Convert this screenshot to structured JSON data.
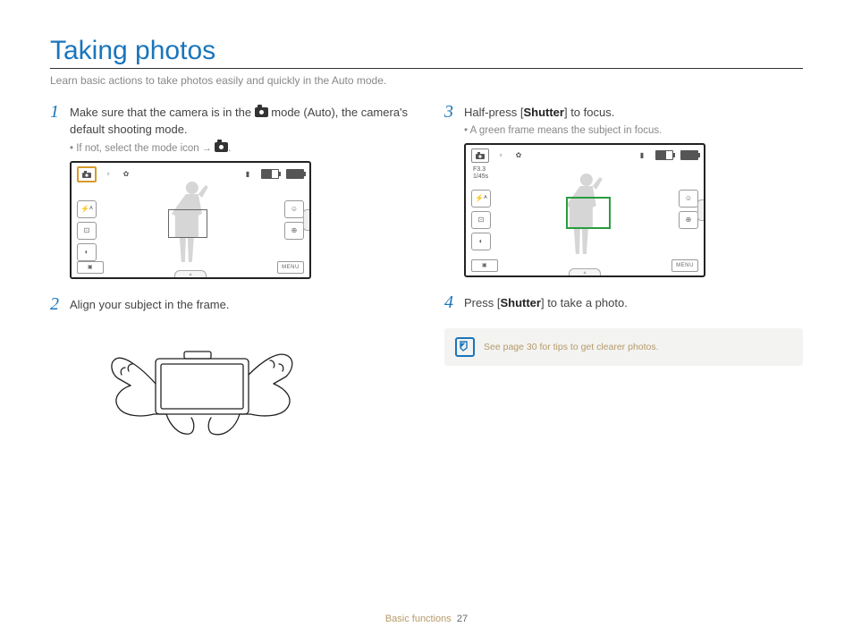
{
  "title": "Taking photos",
  "intro": "Learn basic actions to take photos easily and quickly in the Auto mode.",
  "steps": {
    "s1": {
      "num": "1",
      "text_a": "Make sure that the camera is in the ",
      "text_b": " mode (Auto), the camera's default shooting mode.",
      "bullet_a": "If not, select the mode icon ",
      "arrow": "→",
      "bullet_b": "."
    },
    "s2": {
      "num": "2",
      "text": "Align your subject in the frame."
    },
    "s3": {
      "num": "3",
      "text_a": "Half-press [",
      "shutter": "Shutter",
      "text_b": "] to focus.",
      "bullet": "A green frame means the subject in focus."
    },
    "s4": {
      "num": "4",
      "text_a": "Press [",
      "shutter": "Shutter",
      "text_b": "] to take a photo."
    }
  },
  "screen": {
    "exposure_f": "F3.3",
    "exposure_s": "1/45s",
    "menu_label": "MENU"
  },
  "note": "See page 30 for tips to get clearer photos.",
  "footer": {
    "section": "Basic functions",
    "page": "27"
  }
}
